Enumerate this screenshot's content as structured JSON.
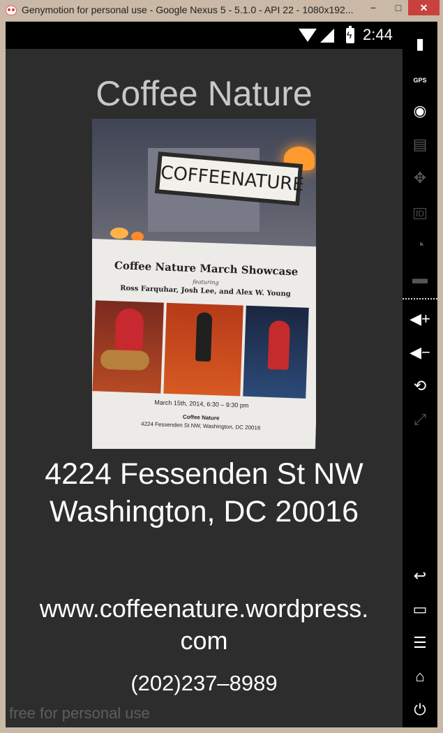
{
  "window": {
    "title": "Genymotion for personal use - Google Nexus 5 - 5.1.0 - API 22 - 1080x192...",
    "minimize_label": "−",
    "maximize_label": "□",
    "close_label": "✕"
  },
  "status_bar": {
    "time": "2:44"
  },
  "app": {
    "title": "Coffee Nature",
    "address_line1": "4224 Fessenden St NW",
    "address_line2": "Washington, DC 20016",
    "website": "www.coffeenature.wordpress.com",
    "phone": "(202)237–8989"
  },
  "poster": {
    "sign_text": "COFFEENATURE",
    "headline": "Coffee Nature March Showcase",
    "featuring": "featuring",
    "performers": "Ross Farquhar, Josh Lee, and Alex W. Young",
    "date_line": "March 15th, 2014, 6:30 – 9:30 pm",
    "venue": "Coffee Nature",
    "venue_address": "4224 Fessenden St NW, Washington, DC 20016"
  },
  "watermark": "free for personal use",
  "sidebar": {
    "icons": [
      "battery-icon",
      "gps-icon",
      "camera-icon",
      "media-icon",
      "dpad-icon",
      "id-icon",
      "rss-icon",
      "sms-icon",
      "volume-up-icon",
      "volume-down-icon",
      "rotate-icon",
      "scale-icon",
      "back-icon",
      "recent-apps-icon",
      "menu-icon",
      "home-icon",
      "power-icon"
    ],
    "gps_label": "GPS",
    "id_label": "ID"
  }
}
